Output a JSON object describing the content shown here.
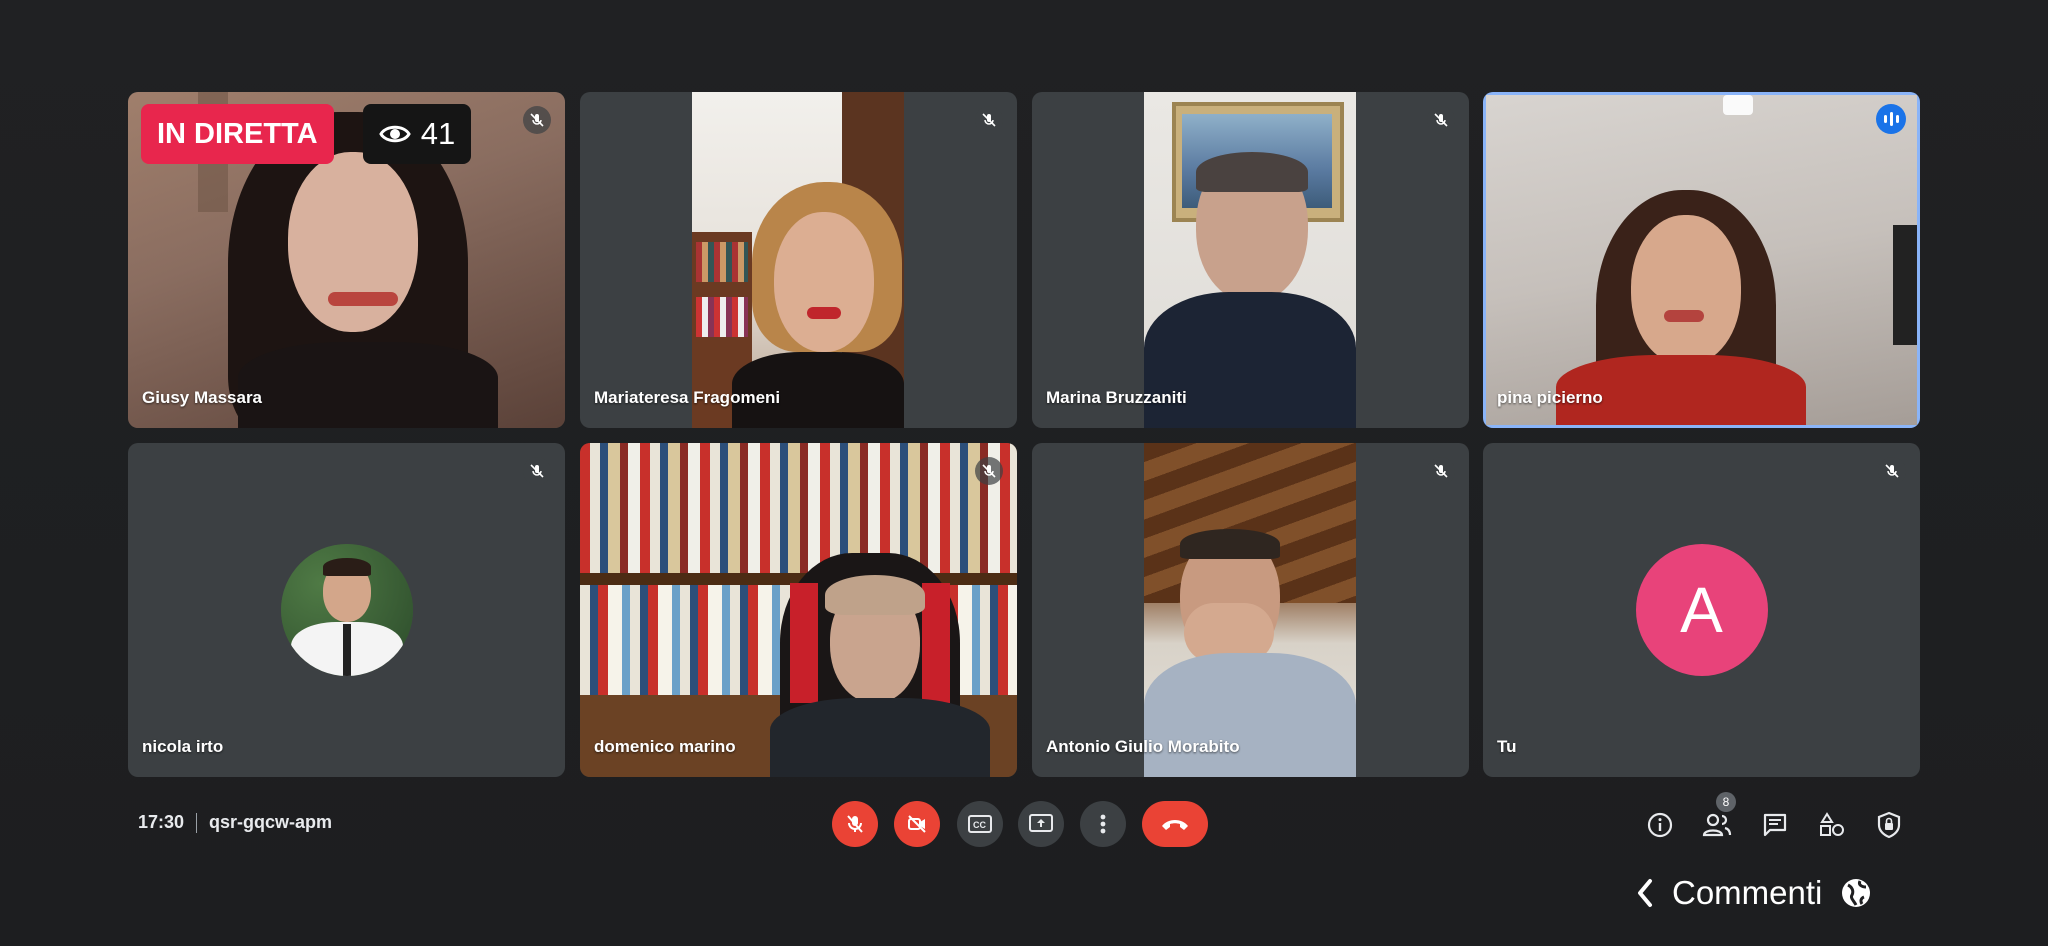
{
  "live": {
    "label": "IN DIRETTA",
    "viewers": "41"
  },
  "participants": [
    {
      "name": "Giusy Massara",
      "muted": true
    },
    {
      "name": "Mariateresa Fragomeni",
      "muted": true
    },
    {
      "name": "Marina Bruzzaniti",
      "muted": true
    },
    {
      "name": "pina picierno",
      "muted": false,
      "speaking": true
    },
    {
      "name": "nicola irto",
      "muted": true
    },
    {
      "name": "domenico marino",
      "muted": true
    },
    {
      "name": "Antonio Giulio Morabito",
      "muted": true
    },
    {
      "name": "Tu",
      "muted": true,
      "avatar_letter": "A"
    }
  ],
  "meeting": {
    "time": "17:30",
    "code": "qsr-gqcw-apm"
  },
  "toolbar": {
    "controls": [
      "mic-off",
      "camera-off",
      "captions",
      "present",
      "more",
      "leave"
    ],
    "right_icons": [
      "info",
      "people",
      "chat",
      "activities",
      "host-controls"
    ],
    "people_count": "8"
  },
  "comments": {
    "label": "Commenti"
  },
  "colors": {
    "live": "#e8264d",
    "danger": "#ea4335",
    "active_border": "#8ab4f8",
    "avatar": "#e8437a"
  }
}
